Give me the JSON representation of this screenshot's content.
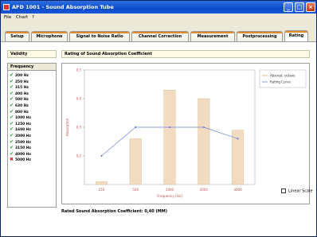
{
  "window": {
    "title": "AFD 1001 - Sound Absorption Tube"
  },
  "menu": [
    "File",
    "Chart",
    "?"
  ],
  "tabs": [
    {
      "label": "Setup",
      "active": false
    },
    {
      "label": "Microphone",
      "active": false
    },
    {
      "label": "Signal to Noise Ratio",
      "active": false
    },
    {
      "label": "Channel Correction",
      "active": false
    },
    {
      "label": "Measurement",
      "active": false
    },
    {
      "label": "Postprocessing",
      "active": false
    },
    {
      "label": "Rating",
      "active": true
    }
  ],
  "validity": {
    "title": "Validity",
    "column_header": "Frequency"
  },
  "frequencies": [
    {
      "label": "200 Hz",
      "valid": true
    },
    {
      "label": "250 Hz",
      "valid": true
    },
    {
      "label": "315 Hz",
      "valid": true
    },
    {
      "label": "400 Hz",
      "valid": true
    },
    {
      "label": "500 Hz",
      "valid": true
    },
    {
      "label": "630 Hz",
      "valid": true
    },
    {
      "label": "800 Hz",
      "valid": true
    },
    {
      "label": "1000 Hz",
      "valid": true
    },
    {
      "label": "1250 Hz",
      "valid": true
    },
    {
      "label": "1600 Hz",
      "valid": true
    },
    {
      "label": "2000 Hz",
      "valid": true
    },
    {
      "label": "2500 Hz",
      "valid": true
    },
    {
      "label": "3150 Hz",
      "valid": true
    },
    {
      "label": "4000 Hz",
      "valid": true
    },
    {
      "label": "5000 Hz",
      "valid": false
    }
  ],
  "rating_panel": {
    "title": "Rating of Sound Absorption Coefficient"
  },
  "linear_scale_label": "Linear Scale",
  "result_text": "Rated Sound Absorption Coefficient: 0,40 (MM)",
  "colors": {
    "bar": "#f1dcc1",
    "bar_stroke": "#d9b88d",
    "curve": "#6f82d8"
  },
  "chart_data": {
    "type": "bar",
    "xlabel": "Frequency [Hz]",
    "ylabel": "Absorption",
    "ylim": [
      0.1,
      0.5
    ],
    "yticks": [
      0.2,
      0.3,
      0.4,
      0.5
    ],
    "ytick_labels": [
      "0,2",
      "0,3",
      "0,4",
      "0,5"
    ],
    "xticks": [
      "250",
      "500",
      "1000",
      "2000",
      "4000"
    ],
    "grid": false,
    "legend_position": "top-right",
    "series": [
      {
        "name": "Absorpt. octave",
        "kind": "bar",
        "categories": [
          "250",
          "500",
          "1000",
          "2000",
          "4000"
        ],
        "values": [
          0.11,
          0.26,
          0.43,
          0.4,
          0.29
        ]
      },
      {
        "name": "Rating Curve",
        "kind": "line",
        "categories": [
          "250",
          "500",
          "1000",
          "2000",
          "4000"
        ],
        "values": [
          0.2,
          0.3,
          0.3,
          0.3,
          0.26
        ]
      }
    ]
  }
}
